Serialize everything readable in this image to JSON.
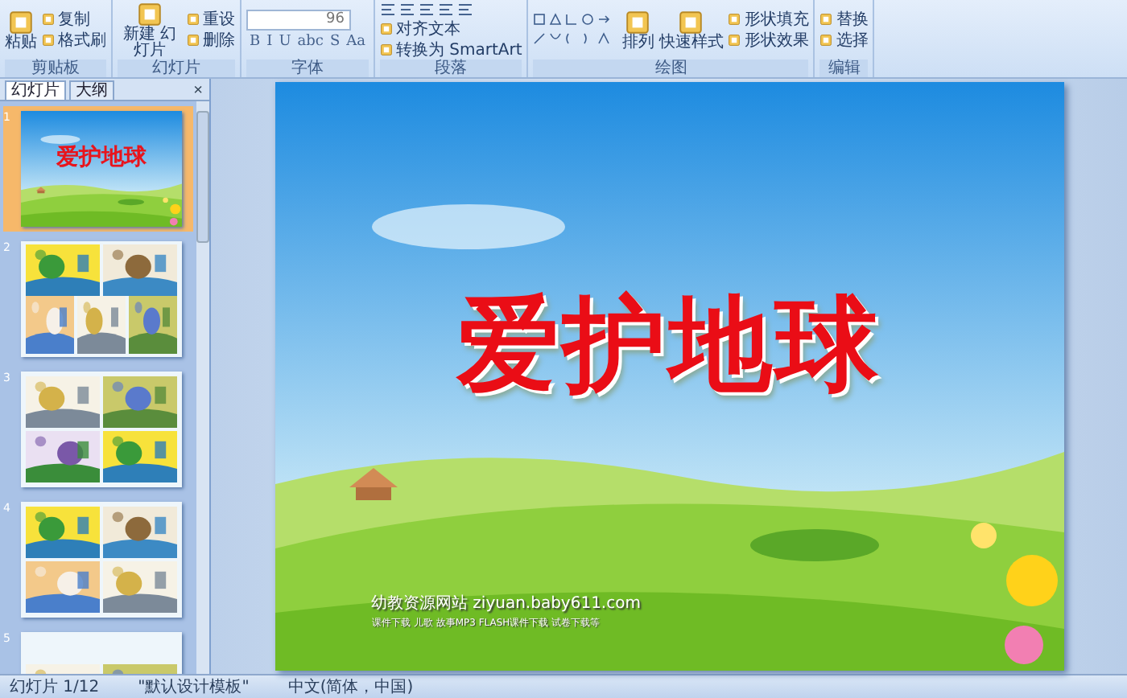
{
  "ribbon": {
    "groups": [
      {
        "label": "剪贴板",
        "kind": "clipboard",
        "items": [
          {
            "kind": "large",
            "label": "粘贴"
          },
          {
            "kind": "small",
            "label": "复制"
          },
          {
            "kind": "small",
            "label": "格式刷"
          }
        ]
      },
      {
        "label": "幻灯片",
        "kind": "slides",
        "items": [
          {
            "kind": "large",
            "label": "新建 幻灯片"
          },
          {
            "kind": "small",
            "label": "重设"
          },
          {
            "kind": "small",
            "label": "删除"
          }
        ]
      },
      {
        "label": "字体",
        "kind": "font",
        "items": [
          {
            "kind": "field",
            "label": "96"
          },
          {
            "kind": "glyph",
            "label": "B"
          },
          {
            "kind": "glyph",
            "label": "I"
          },
          {
            "kind": "glyph",
            "label": "U"
          },
          {
            "kind": "glyph",
            "label": "abc"
          },
          {
            "kind": "glyph",
            "label": "S"
          },
          {
            "kind": "glyph",
            "label": "Aa"
          }
        ]
      },
      {
        "label": "段落",
        "kind": "paragraph",
        "items": [
          {
            "kind": "small",
            "label": "对齐文本"
          },
          {
            "kind": "small",
            "label": "转换为 SmartArt"
          }
        ]
      },
      {
        "label": "绘图",
        "kind": "drawing",
        "items": [
          {
            "kind": "large",
            "label": "排列"
          },
          {
            "kind": "large",
            "label": "快速样式"
          },
          {
            "kind": "small",
            "label": "形状填充"
          },
          {
            "kind": "small",
            "label": "形状效果"
          }
        ]
      },
      {
        "label": "编辑",
        "kind": "editing",
        "items": [
          {
            "kind": "small",
            "label": "替换"
          },
          {
            "kind": "small",
            "label": "选择"
          }
        ]
      }
    ]
  },
  "pane": {
    "tabs": [
      {
        "label": "幻灯片",
        "selected": true
      },
      {
        "label": "大纲",
        "selected": false
      }
    ],
    "close": "×"
  },
  "thumbnails": [
    {
      "number": "1",
      "selected": true,
      "kind": "title",
      "title": "爱护地球"
    },
    {
      "number": "2",
      "selected": false,
      "kind": "collage"
    },
    {
      "number": "3",
      "selected": false,
      "kind": "collage"
    },
    {
      "number": "4",
      "selected": false,
      "kind": "collage"
    },
    {
      "number": "5",
      "selected": false,
      "kind": "collage"
    }
  ],
  "slide": {
    "title": "爱护地球",
    "footer": "幼教资源网站  ziyuan.baby611.com",
    "footer_links": "课件下载   儿歌   故事MP3   FLASH课件下载   试卷下载等"
  },
  "status_bar": {
    "slide": "幻灯片 1/12",
    "template": "\"默认设计模板\"",
    "language": "中文(简体，中国)"
  }
}
